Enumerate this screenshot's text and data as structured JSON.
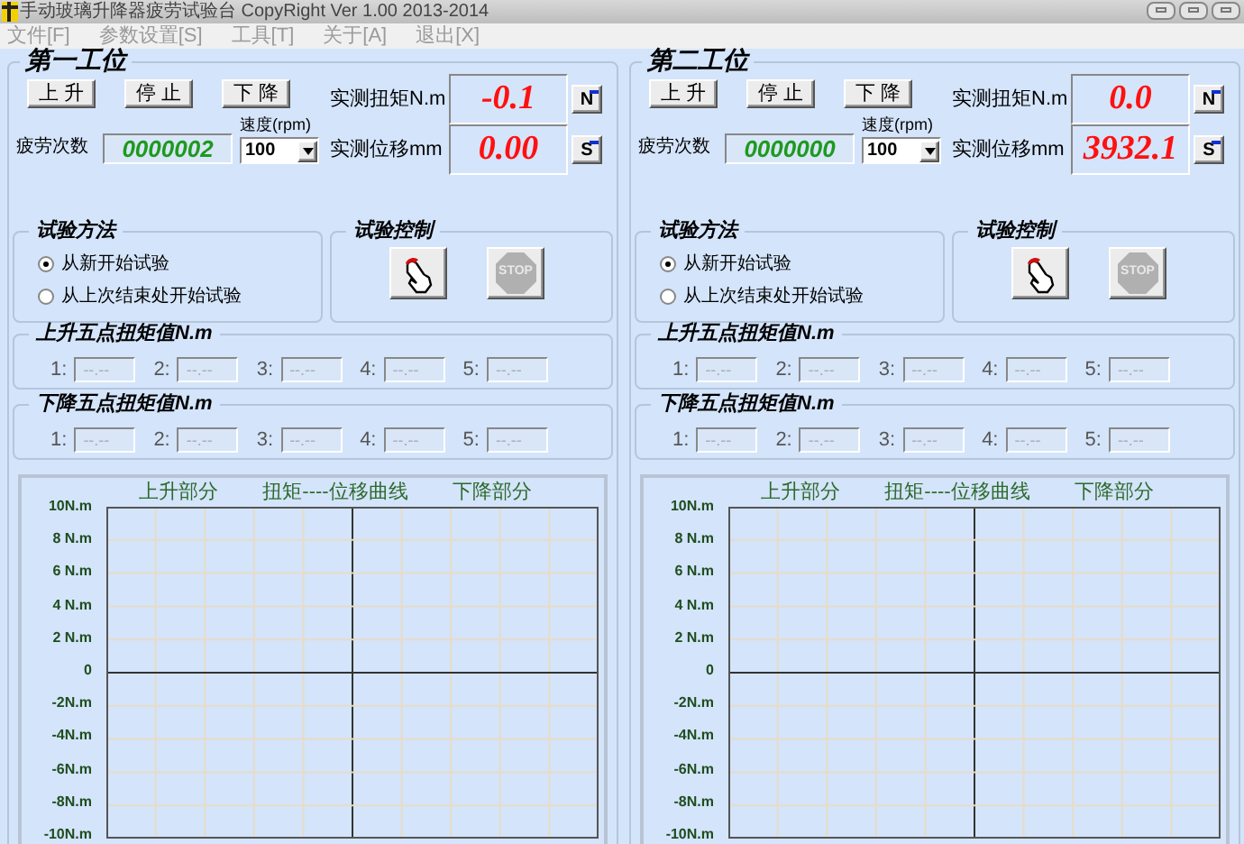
{
  "window": {
    "title": "手动玻璃升降器疲劳试验台 CopyRight Ver 1.00  2013-2014"
  },
  "menu": [
    {
      "label": "文件[F]",
      "disabled": true
    },
    {
      "label": "参数设置[S]",
      "disabled": true
    },
    {
      "label": "工具[T]",
      "disabled": true
    },
    {
      "label": "关于[A]",
      "disabled": true
    },
    {
      "label": "退出[X]",
      "disabled": true
    }
  ],
  "stations": [
    {
      "title": "第一工位",
      "buttons": [
        "上 升",
        "停 止",
        "下 降"
      ],
      "torque_label": "实测扭矩N.m",
      "torque_value": "-0.1",
      "displacement_label": "实测位移mm",
      "displacement_value": "0.00",
      "n_button": "N",
      "s_button": "S",
      "fatigue_label": "疲劳次数",
      "fatigue_count": "0000002",
      "speed_label": "速度(rpm)",
      "speed_value": "100",
      "method": {
        "title": "试验方法",
        "options": [
          {
            "label": "从新开始试验",
            "selected": true
          },
          {
            "label": "从上次结束处开始试验",
            "selected": false
          }
        ]
      },
      "control": {
        "title": "试验控制",
        "stop_label": "STOP"
      },
      "rise": {
        "title": "上升五点扭矩值N.m",
        "points": [
          {
            "label": "1:",
            "value": "--.--",
            "disabled": true
          },
          {
            "label": "2:",
            "value": "--.--",
            "disabled": true
          },
          {
            "label": "3:",
            "value": "--.--",
            "disabled": true
          },
          {
            "label": "4:",
            "value": "--.--",
            "disabled": true
          },
          {
            "label": "5:",
            "value": "--.--",
            "disabled": true
          }
        ]
      },
      "fall": {
        "title": "下降五点扭矩值N.m",
        "points": [
          {
            "label": "1:",
            "value": "--.--",
            "disabled": true
          },
          {
            "label": "2:",
            "value": "--.--",
            "disabled": true
          },
          {
            "label": "3:",
            "value": "--.--",
            "disabled": true
          },
          {
            "label": "4:",
            "value": "--.--",
            "disabled": true
          },
          {
            "label": "5:",
            "value": "--.--",
            "disabled": true
          }
        ]
      },
      "chart": {
        "labels": [
          "上升部分",
          "扭矩----位移曲线",
          "下降部分"
        ],
        "y_labels": [
          "10N.m",
          "8 N.m",
          "6 N.m",
          "4 N.m",
          "2 N.m",
          "0",
          "-2N.m",
          "-4N.m",
          "-6N.m",
          "-8N.m",
          "-10N.m"
        ]
      }
    },
    {
      "title": "第二工位",
      "buttons": [
        "上 升",
        "停 止",
        "下 降"
      ],
      "torque_label": "实测扭矩N.m",
      "torque_value": "0.0",
      "displacement_label": "实测位移mm",
      "displacement_value": "3932.1",
      "n_button": "N",
      "s_button": "S",
      "fatigue_label": "疲劳次数",
      "fatigue_count": "0000000",
      "speed_label": "速度(rpm)",
      "speed_value": "100",
      "method": {
        "title": "试验方法",
        "options": [
          {
            "label": "从新开始试验",
            "selected": true
          },
          {
            "label": "从上次结束处开始试验",
            "selected": false
          }
        ]
      },
      "control": {
        "title": "试验控制",
        "stop_label": "STOP"
      },
      "rise": {
        "title": "上升五点扭矩值N.m",
        "points": [
          {
            "label": "1:",
            "value": "--.--",
            "disabled": true
          },
          {
            "label": "2:",
            "value": "--.--",
            "disabled": true
          },
          {
            "label": "3:",
            "value": "--.--",
            "disabled": true
          },
          {
            "label": "4:",
            "value": "--.--",
            "disabled": true
          },
          {
            "label": "5:",
            "value": "--.--",
            "disabled": true
          }
        ]
      },
      "fall": {
        "title": "下降五点扭矩值N.m",
        "points": [
          {
            "label": "1:",
            "value": "--.--",
            "disabled": true
          },
          {
            "label": "2:",
            "value": "--.--",
            "disabled": true
          },
          {
            "label": "3:",
            "value": "--.--",
            "disabled": true
          },
          {
            "label": "4:",
            "value": "--.--",
            "disabled": true
          },
          {
            "label": "5:",
            "value": "--.--",
            "disabled": true
          }
        ]
      },
      "chart": {
        "labels": [
          "上升部分",
          "扭矩----位移曲线",
          "下降部分"
        ],
        "y_labels": [
          "10N.m",
          "8 N.m",
          "6 N.m",
          "4 N.m",
          "2 N.m",
          "0",
          "-2N.m",
          "-4N.m",
          "-6N.m",
          "-8N.m",
          "-10N.m"
        ]
      }
    }
  ]
}
